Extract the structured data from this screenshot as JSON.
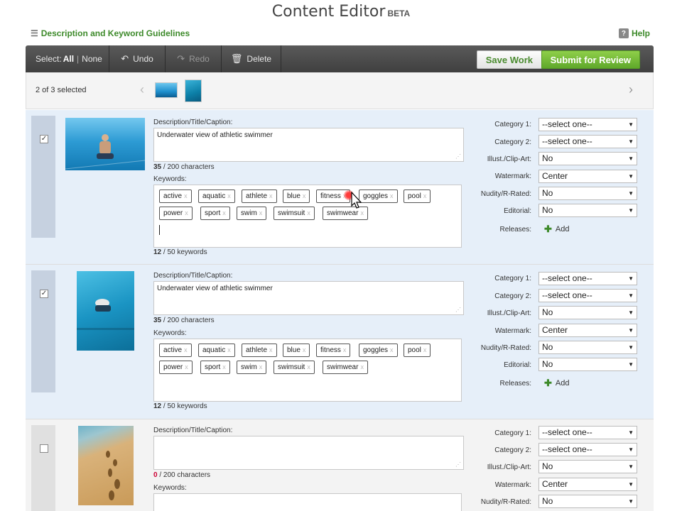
{
  "header": {
    "title": "Content Editor",
    "badge": "BETA"
  },
  "links": {
    "guidelines": "Description and Keyword Guidelines",
    "help": "Help"
  },
  "toolbar": {
    "select_label": "Select:",
    "select_all": "All",
    "select_none": "None",
    "undo": "Undo",
    "redo": "Redo",
    "delete": "Delete",
    "save": "Save Work",
    "submit": "Submit for Review"
  },
  "selection": {
    "count": "2 of 3 selected"
  },
  "labels": {
    "description": "Description/Title/Caption:",
    "keywords": "Keywords:",
    "characters_suffix": " / 200 characters",
    "keywords_suffix": " / 50 keywords",
    "category1": "Category 1:",
    "category2": "Category 2:",
    "illust": "Illust./Clip-Art:",
    "watermark": "Watermark:",
    "nudity": "Nudity/R-Rated:",
    "editorial": "Editorial:",
    "releases": "Releases:",
    "add": "Add"
  },
  "items": [
    {
      "checked": "✓",
      "description": "Underwater view of athletic swimmer",
      "char_count": "35",
      "keyword_count": "12",
      "keywords": [
        "active",
        "aquatic",
        "athlete",
        "blue",
        "fitness",
        "goggles",
        "pool",
        "power",
        "sport",
        "swim",
        "swimsuit",
        "swimwear"
      ],
      "category1": "--select one--",
      "category2": "--select one--",
      "illust": "No",
      "watermark": "Center",
      "nudity": "No",
      "editorial": "No"
    },
    {
      "checked": "✓",
      "description": "Underwater view of athletic swimmer",
      "char_count": "35",
      "keyword_count": "12",
      "keywords": [
        "active",
        "aquatic",
        "athlete",
        "blue",
        "fitness",
        "goggles",
        "pool",
        "power",
        "sport",
        "swim",
        "swimsuit",
        "swimwear"
      ],
      "category1": "--select one--",
      "category2": "--select one--",
      "illust": "No",
      "watermark": "Center",
      "nudity": "No",
      "editorial": "No"
    },
    {
      "checked": "",
      "description": "",
      "char_count": "0",
      "category1": "--select one--",
      "category2": "--select one--",
      "illust": "No",
      "watermark": "Center",
      "nudity": "No"
    }
  ]
}
